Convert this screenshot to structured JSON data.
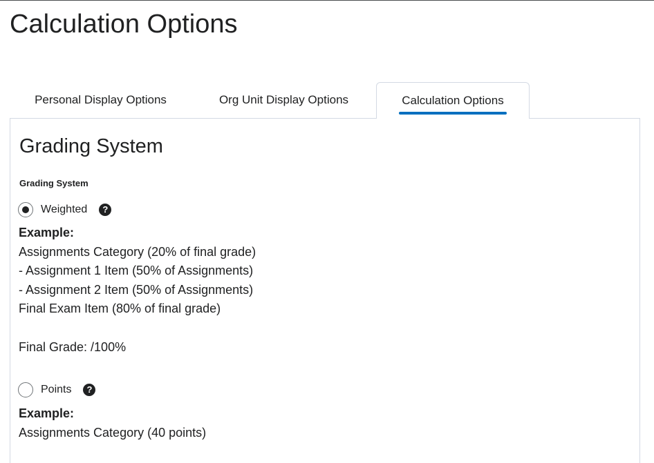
{
  "page": {
    "title": "Calculation Options"
  },
  "tabs": [
    {
      "label": "Personal Display Options",
      "selected": false
    },
    {
      "label": "Org Unit Display Options",
      "selected": false
    },
    {
      "label": "Calculation Options",
      "selected": true
    }
  ],
  "grading_system": {
    "heading": "Grading System",
    "field_label": "Grading System",
    "options": [
      {
        "label": "Weighted",
        "checked": true,
        "help_icon": "question-circle-icon",
        "example_title": "Example:",
        "example_lines": [
          "Assignments Category (20% of final grade)",
          "- Assignment 1 Item (50% of Assignments)",
          "- Assignment 2 Item (50% of Assignments)",
          "Final Exam Item (80% of final grade)",
          "",
          "Final Grade: /100%"
        ]
      },
      {
        "label": "Points",
        "checked": false,
        "help_icon": "question-circle-icon",
        "example_title": "Example:",
        "example_lines": [
          "Assignments Category (40 points)"
        ]
      }
    ]
  },
  "colors": {
    "accent": "#006fbf",
    "text": "#202122",
    "border": "#d3d9e3"
  }
}
